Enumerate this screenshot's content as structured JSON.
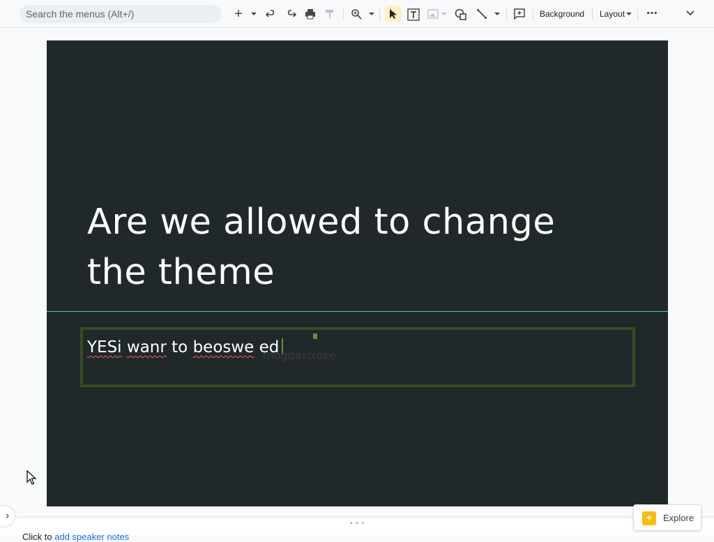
{
  "toolbar": {
    "search_placeholder": "Search the menus (Alt+/)",
    "background_label": "Background",
    "layout_label": "Layout",
    "more_label": "⋯",
    "collapse_label": "⌄",
    "add_label": "+"
  },
  "slide": {
    "title": "Are we allowed to change the theme",
    "body_words": [
      "YESi",
      "wanr",
      "to",
      "beoswe",
      "ed"
    ],
    "ghost_text": "mogdastroke",
    "background_color": "#202829",
    "accent_color": "#5fc7a8"
  },
  "notes": {
    "prefix": "Click to ",
    "link": "add speaker notes"
  },
  "explore": {
    "label": "Explore"
  },
  "side_toggle": {
    "label": "›"
  }
}
